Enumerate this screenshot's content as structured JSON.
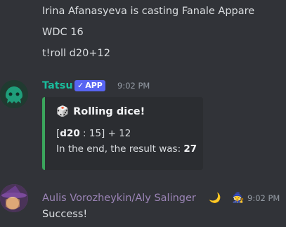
{
  "messages_prev": {
    "line1": "Irina Afanasyeva is casting Fanale Appare",
    "line2": "WDC 16",
    "line3": "t!roll d20+12"
  },
  "tatsu": {
    "name": "Tatsu",
    "badge": "APP",
    "badge_check": "✓",
    "time": "9:02 PM",
    "name_color": "#1abc9c",
    "embed": {
      "icon": "🎲",
      "title": "Rolling dice!",
      "dice_bracket_open": "[",
      "dice_label": "d20",
      "dice_detail": " : 15] + 12",
      "result_prefix": "In the end, the result was: ",
      "result_value": "27",
      "accent": "#3ba55c"
    }
  },
  "aulis": {
    "name": "Aulis Vorozheykin/Aly Salinger",
    "moon_icon": "🌙",
    "badge_icon": "🧙",
    "time": "9:02 PM",
    "name_color": "#9b84b6",
    "message": "Success!"
  }
}
